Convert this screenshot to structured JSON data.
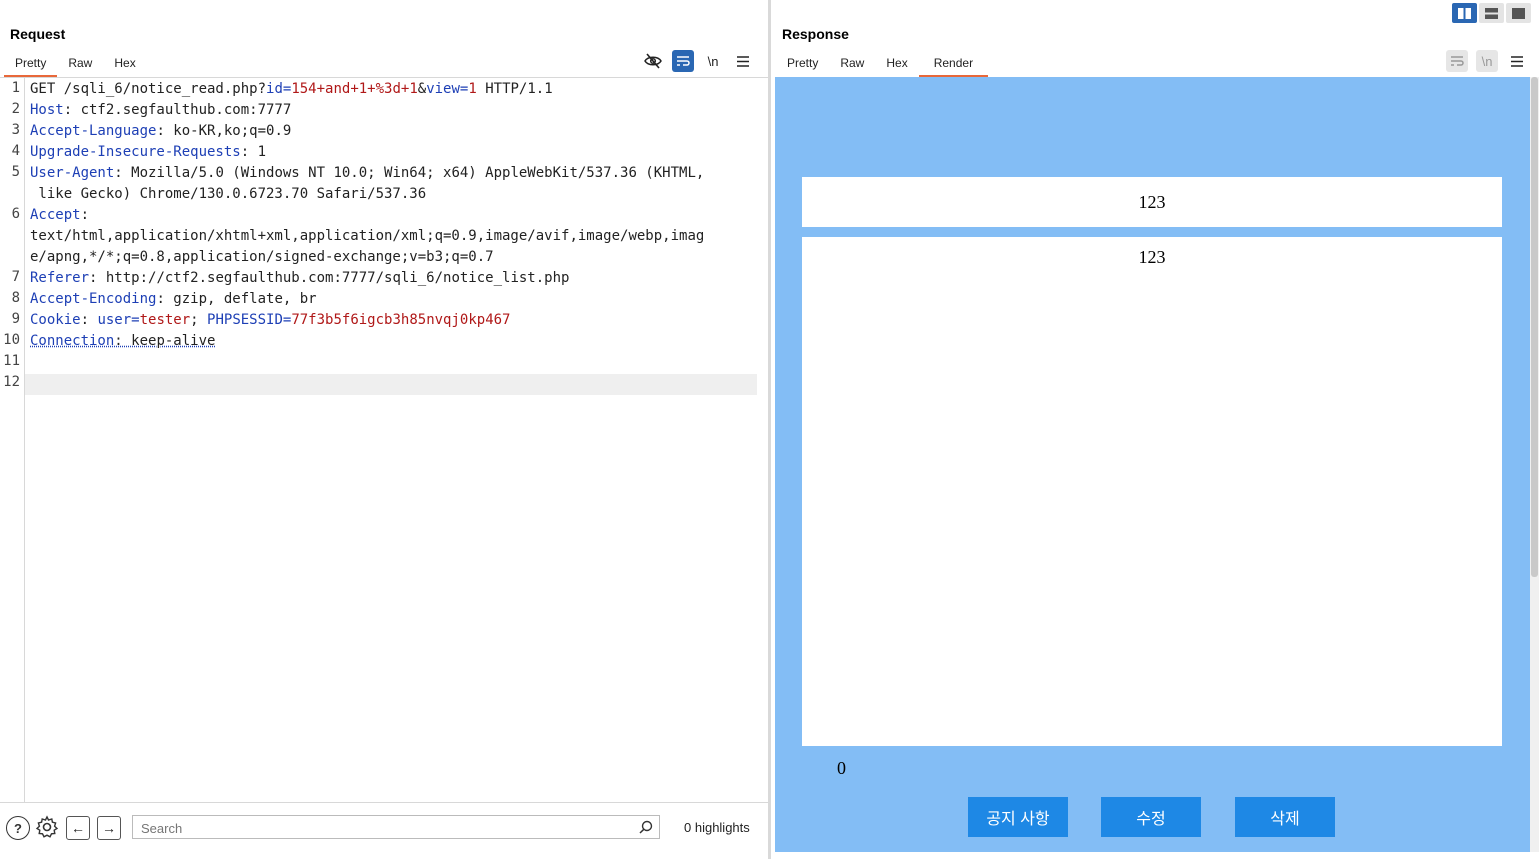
{
  "request": {
    "title": "Request",
    "tabs": [
      "Pretty",
      "Raw",
      "Hex"
    ],
    "active_tab": "Pretty",
    "toolbar_icons": [
      "hide-icon",
      "wrap-icon",
      "newline-icon",
      "menu-icon"
    ],
    "newline_label": "\\n",
    "line_numbers": [
      "1",
      "2",
      "3",
      "4",
      "5",
      "6",
      "7",
      "8",
      "9",
      "10",
      "11",
      "12"
    ],
    "lines": {
      "l1": {
        "a": "GET /sqli_6/notice_read.php?",
        "b": "id",
        "c": "=",
        "d": "154+and+1+%3d+1",
        "e": "&",
        "f": "view",
        "g": "=",
        "h": "1",
        "i": " HTTP/1.1"
      },
      "l2": {
        "k": "Host",
        "v": ": ctf2.segfaulthub.com:7777"
      },
      "l3": {
        "k": "Accept-Language",
        "v": ": ko-KR,ko;q=0.9"
      },
      "l4": {
        "k": "Upgrade-Insecure-Requests",
        "v": ": 1"
      },
      "l5": {
        "k": "User-Agent",
        "v": ": Mozilla/5.0 (Windows NT 10.0; Win64; x64) AppleWebKit/537.36 (KHTML,",
        "v2": " like Gecko) Chrome/130.0.6723.70 Safari/537.36"
      },
      "l6": {
        "k": "Accept",
        "v": ":",
        "v2": "text/html,application/xhtml+xml,application/xml;q=0.9,image/avif,image/webp,imag",
        "v3": "e/apng,*/*;q=0.8,application/signed-exchange;v=b3;q=0.7"
      },
      "l7": {
        "k": "Referer",
        "v": ": http://ctf2.segfaulthub.com:7777/sqli_6/notice_list.php"
      },
      "l8": {
        "k": "Accept-Encoding",
        "v": ": gzip, deflate, br"
      },
      "l9": {
        "k": "Cookie",
        "v": ": ",
        "c1k": "user",
        "eq": "=",
        "c1v": "tester",
        "sep": "; ",
        "c2k": "PHPSESSID",
        "eq2": "=",
        "c2v": "77f3b5f6igcb3h85nvqj0kp467"
      },
      "l10": {
        "k": "Connection",
        "v": ": keep-alive"
      }
    },
    "search_placeholder": "Search",
    "highlights": "0 highlights"
  },
  "response": {
    "title": "Response",
    "tabs": [
      "Pretty",
      "Raw",
      "Hex",
      "Render"
    ],
    "active_tab": "Render",
    "newline_label": "\\n",
    "render": {
      "title_value": "123",
      "content_value": "123",
      "count": "0",
      "buttons": [
        "공지 사항",
        "수정",
        "삭제"
      ]
    }
  },
  "colors": {
    "accent": "#2a67b3",
    "tab_underline": "#e8683a",
    "render_bg": "#83bdf5",
    "render_button": "#1e88e5",
    "header_key": "#1d3fb5",
    "param_value": "#b01818"
  }
}
